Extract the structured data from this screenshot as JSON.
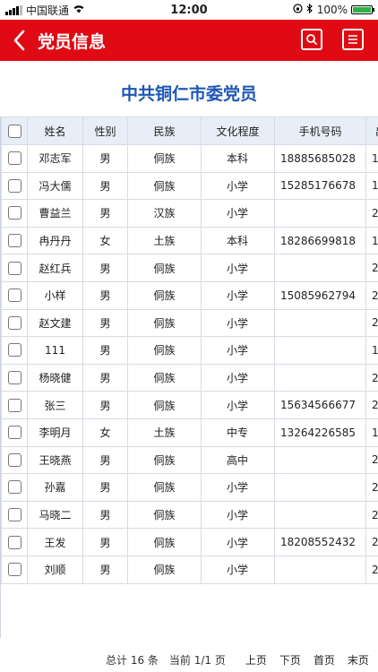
{
  "statusbar": {
    "carrier": "中国联通",
    "time": "12:00",
    "battery": "100%"
  },
  "navbar": {
    "title": "党员信息",
    "icons": [
      "back-chevron-icon",
      "search-icon",
      "list-icon"
    ]
  },
  "page_title": "中共铜仁市委党员",
  "table": {
    "headers": [
      "姓名",
      "性别",
      "民族",
      "文化程度",
      "手机号码",
      "出"
    ],
    "rows": [
      {
        "name": "邓志军",
        "gender": "男",
        "nation": "侗族",
        "edu": "本科",
        "phone": "18885685028",
        "last": "1"
      },
      {
        "name": "冯大儒",
        "gender": "男",
        "nation": "侗族",
        "edu": "小学",
        "phone": "15285176678",
        "last": "1"
      },
      {
        "name": "曹益兰",
        "gender": "男",
        "nation": "汉族",
        "edu": "小学",
        "phone": "",
        "last": "2"
      },
      {
        "name": "冉丹丹",
        "gender": "女",
        "nation": "土族",
        "edu": "本科",
        "phone": "18286699818",
        "last": "1"
      },
      {
        "name": "赵红兵",
        "gender": "男",
        "nation": "侗族",
        "edu": "小学",
        "phone": "",
        "last": "2"
      },
      {
        "name": "小样",
        "gender": "男",
        "nation": "侗族",
        "edu": "小学",
        "phone": "15085962794",
        "last": "2"
      },
      {
        "name": "赵文建",
        "gender": "男",
        "nation": "侗族",
        "edu": "小学",
        "phone": "",
        "last": "2"
      },
      {
        "name": "111",
        "gender": "男",
        "nation": "侗族",
        "edu": "小学",
        "phone": "",
        "last": "1"
      },
      {
        "name": "杨晓健",
        "gender": "男",
        "nation": "侗族",
        "edu": "小学",
        "phone": "",
        "last": "2"
      },
      {
        "name": "张三",
        "gender": "男",
        "nation": "侗族",
        "edu": "小学",
        "phone": "15634566677",
        "last": "2"
      },
      {
        "name": "李明月",
        "gender": "女",
        "nation": "土族",
        "edu": "中专",
        "phone": "13264226585",
        "last": "1"
      },
      {
        "name": "王晓燕",
        "gender": "男",
        "nation": "侗族",
        "edu": "高中",
        "phone": "",
        "last": "2"
      },
      {
        "name": "孙嘉",
        "gender": "男",
        "nation": "侗族",
        "edu": "小学",
        "phone": "",
        "last": "2"
      },
      {
        "name": "马晓二",
        "gender": "男",
        "nation": "侗族",
        "edu": "小学",
        "phone": "",
        "last": "2"
      },
      {
        "name": "王发",
        "gender": "男",
        "nation": "侗族",
        "edu": "小学",
        "phone": "18208552432",
        "last": "2"
      },
      {
        "name": "刘顺",
        "gender": "男",
        "nation": "侗族",
        "edu": "小学",
        "phone": "",
        "last": "2"
      }
    ]
  },
  "footer": {
    "total": "总计 16 条",
    "current": "当前 1/1 页",
    "prev": "上页",
    "next": "下页",
    "first": "首页",
    "last": "末页"
  },
  "colors": {
    "navbar": "#e00a14",
    "title": "#1f57b4",
    "header_bg": "#e8eef7"
  }
}
